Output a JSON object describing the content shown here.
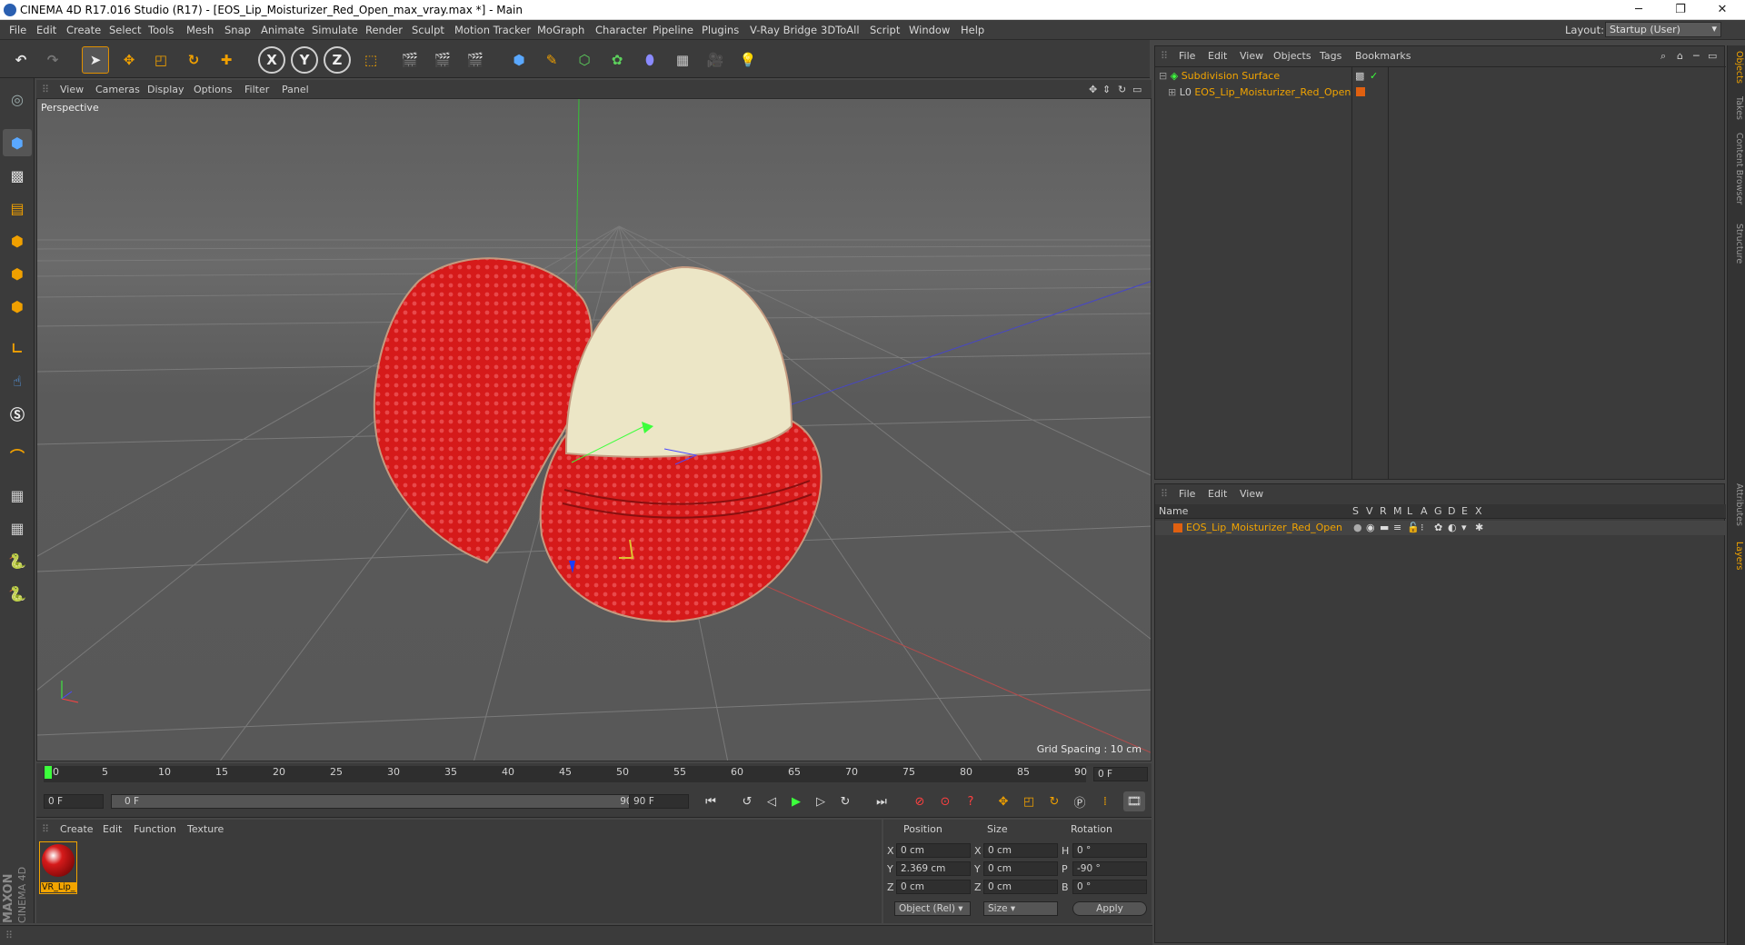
{
  "window": {
    "title": "CINEMA 4D R17.016 Studio (R17) - [EOS_Lip_Moisturizer_Red_Open_max_vray.max *] - Main",
    "min": "─",
    "max": "❐",
    "close": "✕"
  },
  "menu": [
    "File",
    "Edit",
    "Create",
    "Select",
    "Tools",
    "Mesh",
    "Snap",
    "Animate",
    "Simulate",
    "Render",
    "Sculpt",
    "Motion Tracker",
    "MoGraph",
    "Character",
    "Pipeline",
    "Plugins",
    "V-Ray Bridge",
    "3DToAll",
    "Script",
    "Window",
    "Help"
  ],
  "layout": {
    "label": "Layout:",
    "value": "Startup (User)"
  },
  "toolbar": {
    "x": "X",
    "y": "Y",
    "z": "Z"
  },
  "viewport": {
    "menu": [
      "View",
      "Cameras",
      "Display",
      "Options",
      "Filter",
      "Panel"
    ],
    "label": "Perspective",
    "grid_spacing": "Grid Spacing : 10 cm"
  },
  "timeline": {
    "ticks": [
      "0",
      "5",
      "10",
      "15",
      "20",
      "25",
      "30",
      "35",
      "40",
      "45",
      "50",
      "55",
      "60",
      "65",
      "70",
      "75",
      "80",
      "85",
      "90"
    ],
    "current_frame": "0 F",
    "start": "0 F",
    "range_start": "0 F",
    "range_end": "90 F",
    "end": "90 F"
  },
  "materials": {
    "menu": [
      "Create",
      "Edit",
      "Function",
      "Texture"
    ],
    "items": [
      {
        "label": "VR_Lip_"
      }
    ],
    "brand_top": "MAXON",
    "brand_bottom": "CINEMA 4D"
  },
  "coords": {
    "headers": [
      "Position",
      "Size",
      "Rotation"
    ],
    "rows": [
      {
        "axis": "X",
        "pos": "0 cm",
        "saxis": "X",
        "size": "0 cm",
        "raxis": "H",
        "rot": "0 °"
      },
      {
        "axis": "Y",
        "pos": "2.369 cm",
        "saxis": "Y",
        "size": "0 cm",
        "raxis": "P",
        "rot": "-90 °"
      },
      {
        "axis": "Z",
        "pos": "0 cm",
        "saxis": "Z",
        "size": "0 cm",
        "raxis": "B",
        "rot": "0 °"
      }
    ],
    "mode": "Object (Rel)",
    "size_mode": "Size",
    "apply": "Apply"
  },
  "objects": {
    "menu": [
      "File",
      "Edit",
      "View",
      "Objects",
      "Tags",
      "Bookmarks"
    ],
    "items": [
      "Subdivision Surface",
      "EOS_Lip_Moisturizer_Red_Open"
    ]
  },
  "layers": {
    "menu": [
      "File",
      "Edit",
      "View"
    ],
    "name_header": "Name",
    "cols": [
      "S",
      "V",
      "R",
      "M",
      "L",
      "A",
      "G",
      "D",
      "E",
      "X"
    ],
    "item": "EOS_Lip_Moisturizer_Red_Open"
  },
  "rtabs": [
    "Objects",
    "Takes",
    "Content Browser",
    "Structure",
    "Attributes",
    "Layers"
  ],
  "colors": {
    "accent": "#f2a400",
    "green": "#3cff3c",
    "material": "#d61a1a"
  }
}
